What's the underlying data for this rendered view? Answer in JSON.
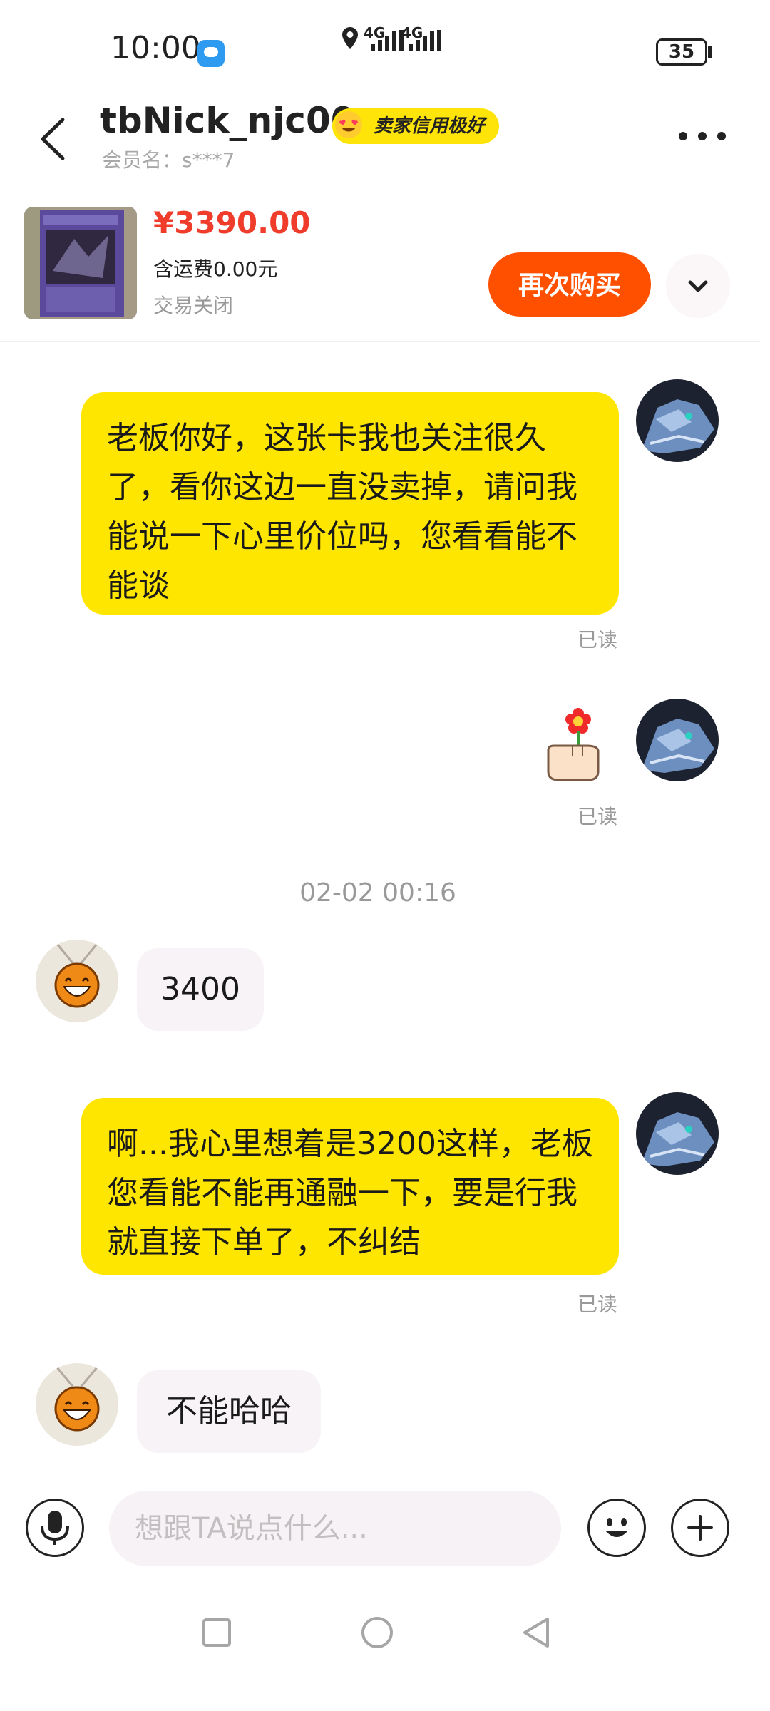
{
  "status_bar": {
    "time": "10:00",
    "network_1": "4G",
    "network_2": "4G",
    "battery": "35"
  },
  "header": {
    "title": "tbNick_njc00",
    "badge": "卖家信用极好",
    "member_name": "会员名：s***7"
  },
  "product": {
    "price": "¥3390.00",
    "shipping": "含运费0.00元",
    "status": "交易关闭",
    "rebuy_label": "再次购买"
  },
  "messages": [
    {
      "side": "out",
      "text": "老板你好，这张卡我也关注很久了，看你这边一直没卖掉，请问我能说一下心里价位吗，您看看能不能谈",
      "read": "已读"
    },
    {
      "side": "out",
      "type": "sticker",
      "sticker": "flower-hand-icon",
      "read": "已读"
    },
    {
      "side": "in",
      "text": "3400"
    },
    {
      "side": "out",
      "text": "啊...我心里想着是3200这样，老板您看能不能再通融一下，要是行我就直接下单了，不纠结",
      "read": "已读"
    },
    {
      "side": "in",
      "text": "不能哈哈"
    }
  ],
  "timestamp": "02-02 00:16",
  "input": {
    "placeholder": "想跟TA说点什么..."
  },
  "colors": {
    "bubble_out": "#ffe600",
    "bubble_in": "#f7f3f6",
    "price": "#f03c2b",
    "cta": "#ff5000",
    "badge": "#ffe40a"
  }
}
